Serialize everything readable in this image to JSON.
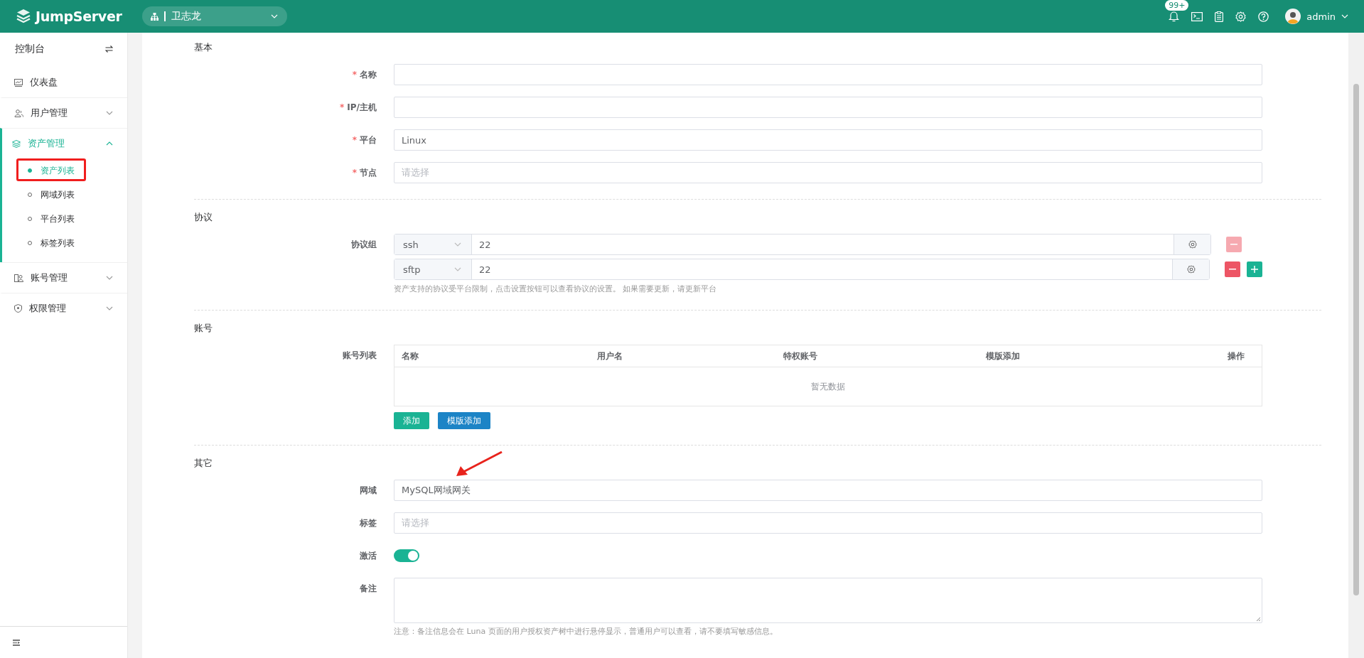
{
  "header": {
    "logo": "JumpServer",
    "org": "卫志龙",
    "notification_badge": "99+",
    "user": "admin"
  },
  "sidebar": {
    "title": "控制台",
    "items": [
      {
        "label": "仪表盘",
        "kind": "link",
        "selected": false
      },
      {
        "label": "用户管理",
        "kind": "group",
        "expanded": false,
        "selected": false
      },
      {
        "label": "资产管理",
        "kind": "group",
        "expanded": true,
        "selected": true,
        "children": [
          {
            "label": "资产列表",
            "selected": true
          },
          {
            "label": "网域列表",
            "selected": false
          },
          {
            "label": "平台列表",
            "selected": false
          },
          {
            "label": "标签列表",
            "selected": false
          }
        ]
      },
      {
        "label": "账号管理",
        "kind": "group",
        "expanded": false,
        "selected": false
      },
      {
        "label": "权限管理",
        "kind": "group",
        "expanded": false,
        "selected": false
      }
    ]
  },
  "form": {
    "sections": [
      {
        "title": "基本",
        "rows": [
          {
            "label": "名称",
            "kind": "input",
            "required_mark": "*"
          },
          {
            "label": "IP/主机",
            "kind": "input",
            "required_mark": "*"
          },
          {
            "label": "平台",
            "kind": "input",
            "required_mark": "*",
            "value": "Linux"
          },
          {
            "label": "节点",
            "kind": "input",
            "required_mark": "*",
            "placeholder": "请选择"
          }
        ]
      },
      {
        "title": "协议",
        "rows": [
          {
            "label": "协议组",
            "kind": "protocols",
            "protocols": [
              {
                "name": "ssh",
                "port": "22",
                "remove_disabled": true,
                "add": false
              },
              {
                "name": "sftp",
                "port": "22",
                "remove_disabled": false,
                "add": true
              }
            ],
            "help": "资产支持的协议受平台限制，点击设置按钮可以查看协议的设置。 如果需要更新，请更新平台"
          }
        ]
      },
      {
        "title": "账号",
        "rows": [
          {
            "label": "账号列表",
            "kind": "table",
            "columns": [
              "名称",
              "用户名",
              "特权账号",
              "模版添加",
              "操作"
            ],
            "empty_text": "暂无数据",
            "buttons": [
              {
                "label": "添加",
                "kind": "primary"
              },
              {
                "label": "模版添加",
                "kind": "info"
              }
            ]
          }
        ]
      },
      {
        "title": "其它",
        "rows": [
          {
            "label": "网域",
            "kind": "input",
            "value": "MySQL网域网关"
          },
          {
            "label": "标签",
            "kind": "input",
            "placeholder": "请选择"
          },
          {
            "label": "激活",
            "kind": "toggle",
            "on": true
          },
          {
            "label": "备注",
            "kind": "textarea",
            "help": "注意：备注信息会在 Luna 页面的用户授权资产树中进行悬停显示，普通用户可以查看，请不要填写敏感信息。"
          }
        ]
      }
    ]
  }
}
